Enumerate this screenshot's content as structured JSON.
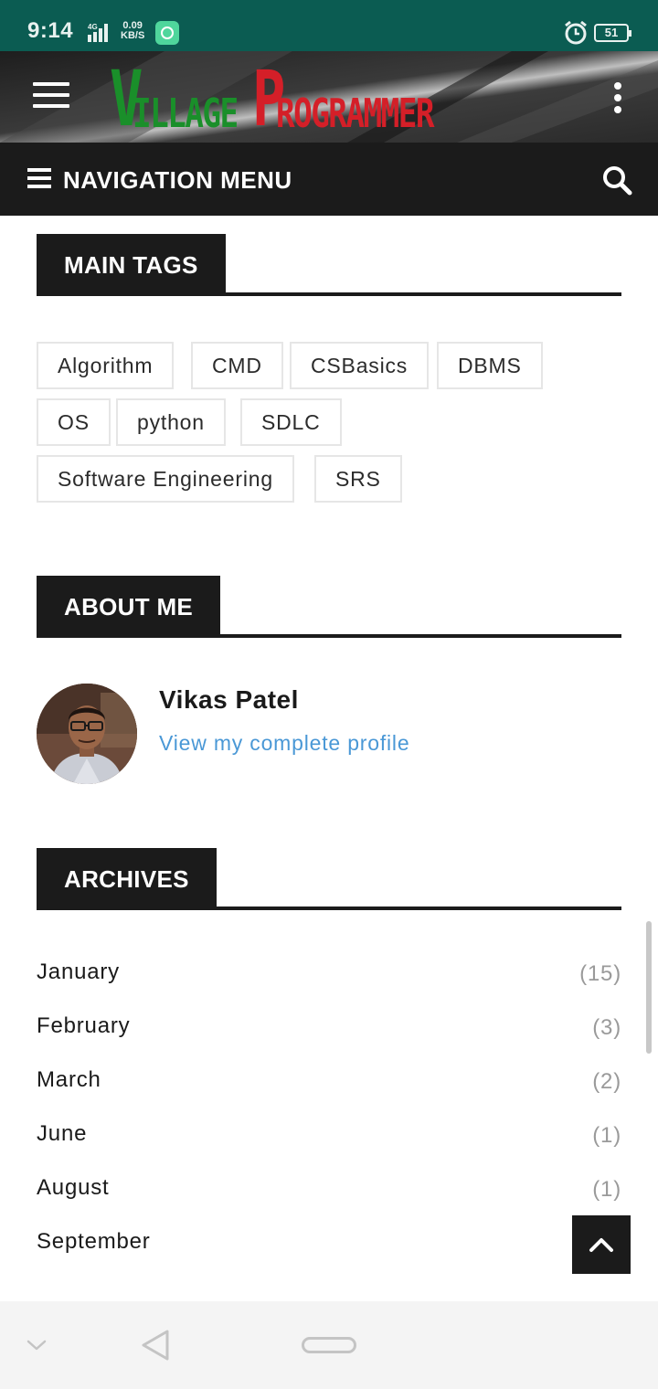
{
  "status_bar": {
    "time": "9:14",
    "network": "4G",
    "speed_value": "0.09",
    "speed_unit": "KB/S",
    "battery": "51",
    "bg_color": "#0b5c52"
  },
  "header": {
    "logo_v": "V",
    "logo_village": "ILLAGE",
    "logo_p": "P",
    "logo_programmer": "ROGRAMMER",
    "logo_green": "#1a8f2a",
    "logo_red": "#d41f28",
    "menu_icon": "hamburger-icon",
    "overflow_icon": "kebab-icon"
  },
  "nav": {
    "label": "NAVIGATION MENU",
    "search_icon": "search-icon"
  },
  "main_tags": {
    "title": "MAIN TAGS",
    "tags": [
      "Algorithm",
      "CMD",
      "CSBasics",
      "DBMS",
      "OS",
      "python",
      "SDLC",
      "Software Engineering",
      "SRS"
    ]
  },
  "about": {
    "title": "ABOUT ME",
    "name": "Vikas Patel",
    "link": "View my complete profile",
    "link_color": "#4a98d6"
  },
  "archives": {
    "title": "ARCHIVES",
    "items": [
      {
        "month": "January",
        "count": "(15)"
      },
      {
        "month": "February",
        "count": "(3)"
      },
      {
        "month": "March",
        "count": "(2)"
      },
      {
        "month": "June",
        "count": "(1)"
      },
      {
        "month": "August",
        "count": "(1)"
      },
      {
        "month": "September",
        "count": ""
      }
    ]
  },
  "back_to_top_icon": "chevron-up-icon"
}
